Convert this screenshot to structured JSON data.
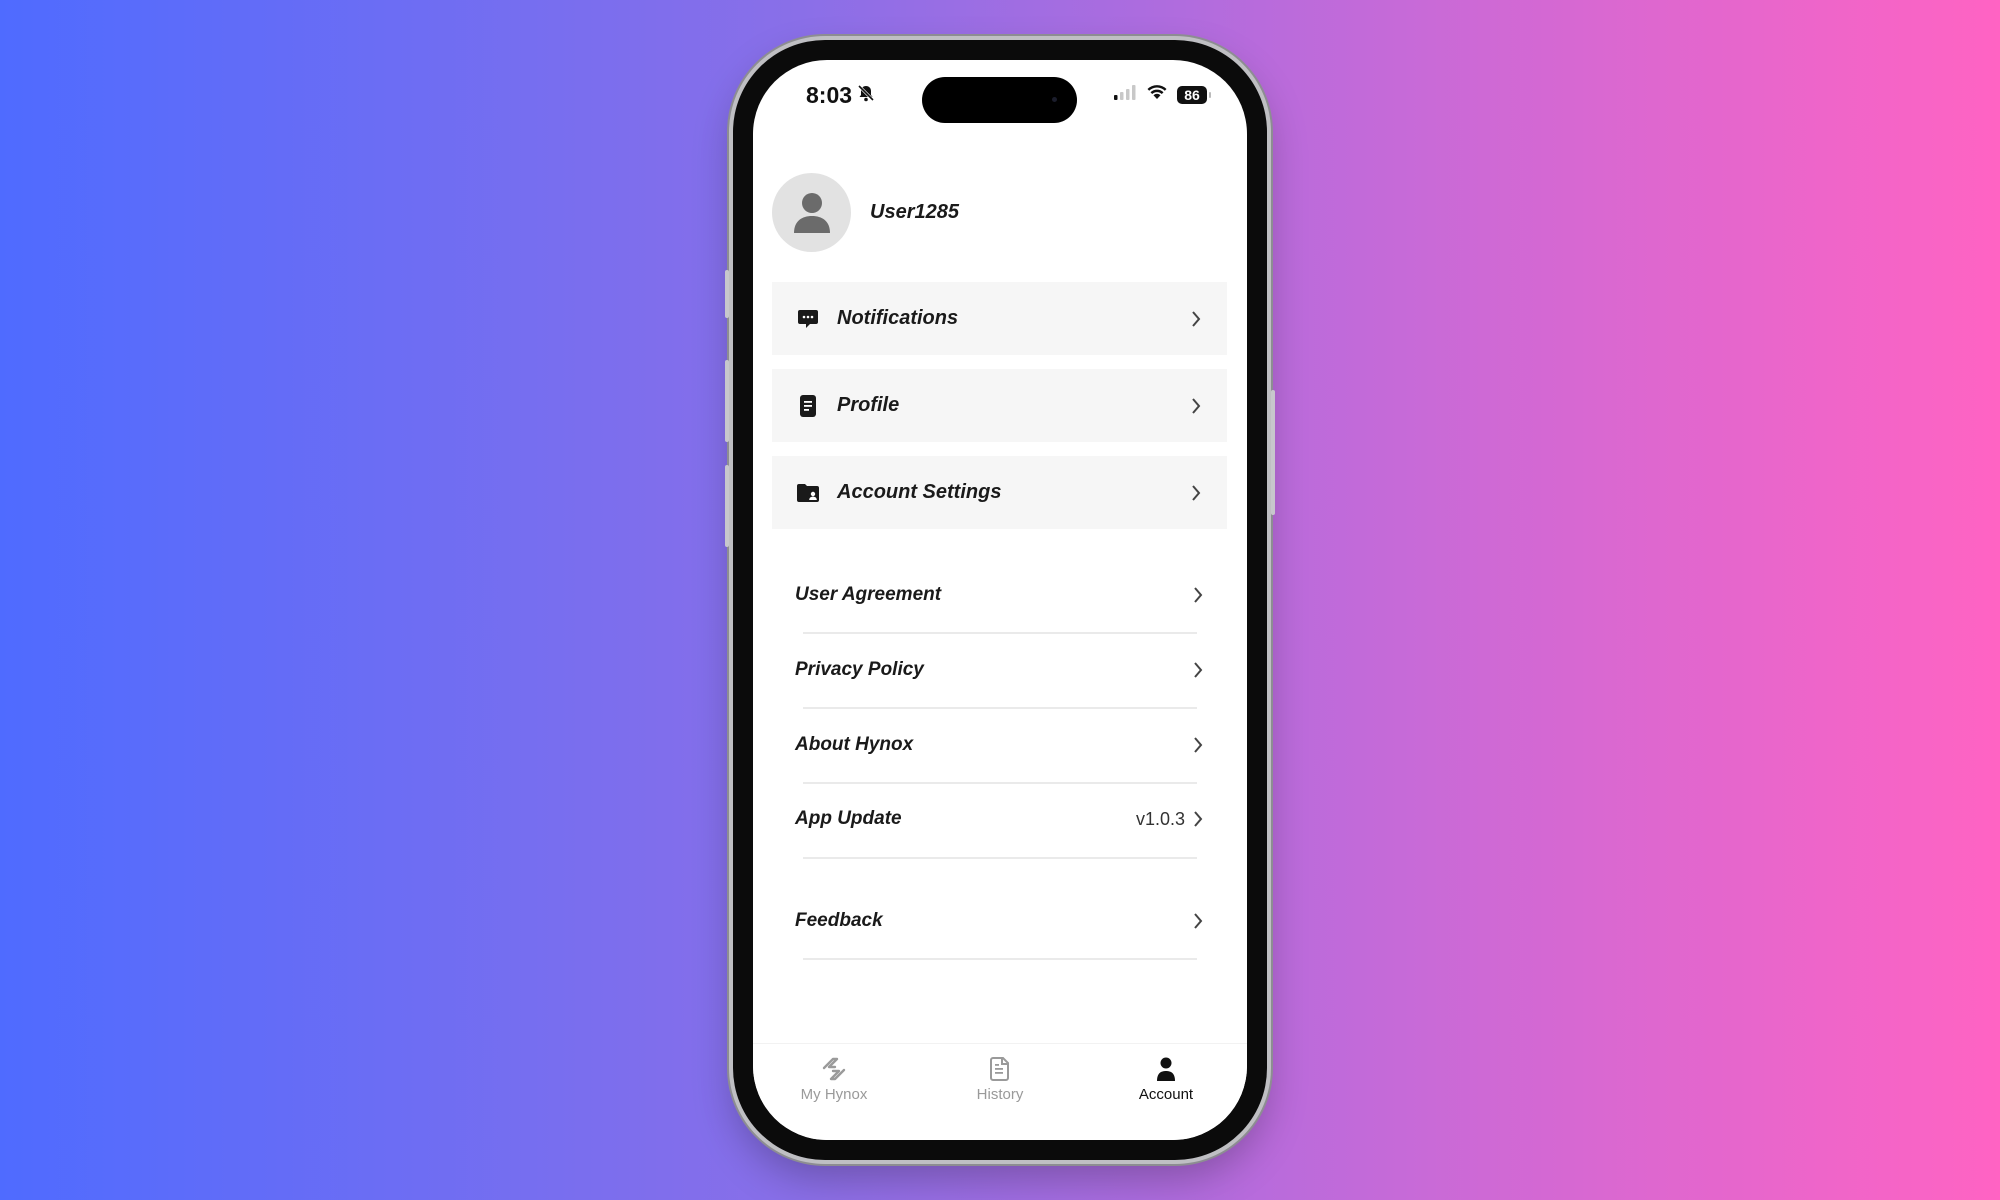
{
  "status_bar": {
    "time": "8:03",
    "battery": "86"
  },
  "user": {
    "name": "User1285"
  },
  "menu_cards": [
    {
      "label": "Notifications",
      "icon": "message-icon"
    },
    {
      "label": "Profile",
      "icon": "document-icon"
    },
    {
      "label": "Account Settings",
      "icon": "folder-user-icon"
    }
  ],
  "menu_rows": [
    {
      "label": "User Agreement",
      "value": ""
    },
    {
      "label": "Privacy Policy",
      "value": ""
    },
    {
      "label": "About Hynox",
      "value": ""
    },
    {
      "label": "App Update",
      "value": "v1.0.3"
    },
    {
      "label": "Feedback",
      "value": ""
    }
  ],
  "tab_bar": {
    "tabs": [
      {
        "label": "My Hynox",
        "icon": "hynox-logo-icon",
        "active": false
      },
      {
        "label": "History",
        "icon": "history-document-icon",
        "active": false
      },
      {
        "label": "Account",
        "icon": "person-icon",
        "active": true
      }
    ]
  },
  "colors": {
    "background_left": "#4f6bff",
    "background_right": "#ff63c3",
    "card_bg": "#f6f6f6",
    "text_primary": "#1a1a1a",
    "tab_inactive": "#9a9a9a"
  }
}
